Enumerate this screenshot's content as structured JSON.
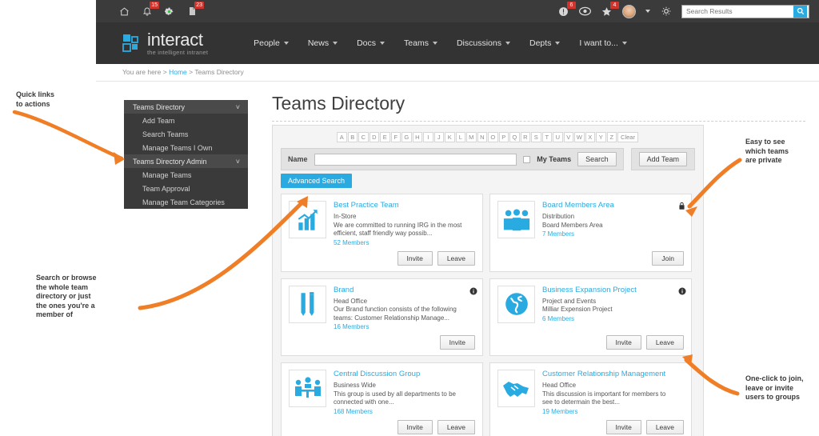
{
  "topbar": {
    "left_icons": [
      {
        "name": "home-icon",
        "badge": null
      },
      {
        "name": "bell-icon",
        "badge": "15"
      },
      {
        "name": "settings-gear-icon",
        "badge": null
      },
      {
        "name": "document-icon",
        "badge": "23"
      }
    ],
    "right_icons": [
      {
        "name": "alert-icon",
        "badge": "6"
      },
      {
        "name": "eye-icon",
        "badge": null
      },
      {
        "name": "star-icon",
        "badge": "4"
      }
    ],
    "avatar_name": "user-avatar",
    "search": {
      "placeholder": "Search Results",
      "value": ""
    }
  },
  "brand": {
    "name": "interact",
    "tagline": "the intelligent intranet"
  },
  "nav": [
    {
      "label": "People"
    },
    {
      "label": "News"
    },
    {
      "label": "Docs"
    },
    {
      "label": "Teams"
    },
    {
      "label": "Discussions"
    },
    {
      "label": "Depts"
    },
    {
      "label": "I want to..."
    }
  ],
  "breadcrumb": {
    "prefix": "You are here >",
    "home": "Home",
    "suffix": "> Teams Directory"
  },
  "sidebar": {
    "groups": [
      {
        "title": "Teams Directory",
        "chevron": "chevron-down-icon",
        "items": [
          "Add Team",
          "Search Teams",
          "Manage Teams I Own"
        ]
      },
      {
        "title": "Teams Directory Admin",
        "chevron": "chevron-down-icon",
        "items": [
          "Manage Teams",
          "Team Approval",
          "Manage Team Categories"
        ]
      }
    ]
  },
  "main": {
    "title": "Teams Directory",
    "alphabet": [
      "A",
      "B",
      "C",
      "D",
      "E",
      "F",
      "G",
      "H",
      "I",
      "J",
      "K",
      "L",
      "M",
      "N",
      "O",
      "P",
      "Q",
      "R",
      "S",
      "T",
      "U",
      "V",
      "W",
      "X",
      "Y",
      "Z"
    ],
    "clear_label": "Clear",
    "search": {
      "name_label": "Name",
      "name_value": "",
      "my_teams_label": "My Teams",
      "my_teams_checked": false,
      "search_button": "Search",
      "add_team_button": "Add Team",
      "advanced_search_button": "Advanced Search"
    },
    "cards": [
      {
        "title": "Best Practice Team",
        "category": "In-Store",
        "description": "We are committed to running IRG in the most efficient, staff friendly way possib...",
        "members": "52 Members",
        "flag": null,
        "icon": "bar-chart-icon",
        "actions": [
          "Invite",
          "Leave"
        ]
      },
      {
        "title": "Board Members Area",
        "category": "Distribution",
        "description": "Board Members Area",
        "members": "7 Members",
        "flag": "lock-icon",
        "icon": "people-group-icon",
        "actions": [
          "Join"
        ]
      },
      {
        "title": "Brand",
        "category": "Head Office",
        "description": "Our Brand function consists of the following teams: Customer Relationship Manage...",
        "members": "16 Members",
        "flag": "info-icon",
        "icon": "pencils-icon",
        "actions": [
          "Invite"
        ]
      },
      {
        "title": "Business Expansion Project",
        "category": "Project and Events",
        "description": "Milliar Expension Project",
        "members": "6 Members",
        "flag": "info-icon",
        "icon": "globe-icon",
        "actions": [
          "Invite",
          "Leave"
        ]
      },
      {
        "title": "Central Discussion Group",
        "category": "Business Wide",
        "description": "This group is used by all departments to be connected with one...",
        "members": "168 Members",
        "flag": null,
        "icon": "meeting-icon",
        "actions": [
          "Invite",
          "Leave"
        ]
      },
      {
        "title": "Customer Relationship Management",
        "category": "Head Office",
        "description": "This discussion is important for members to see to determain the best...",
        "members": "19 Members",
        "flag": null,
        "icon": "handshake-icon",
        "actions": [
          "Invite",
          "Leave"
        ]
      }
    ]
  },
  "annotations": [
    {
      "id": "a1",
      "text": "Quick links\nto actions"
    },
    {
      "id": "a2",
      "text": "Search or browse\nthe whole team\ndirectory or just\nthe ones you're a\nmember of"
    },
    {
      "id": "a3",
      "text": "Easy to see\nwhich teams\nare private"
    },
    {
      "id": "a4",
      "text": "One-click to join,\nleave or invite\nusers to groups"
    }
  ],
  "colors": {
    "accent": "#29ABE2",
    "annotation": "#F07E26",
    "header": "#333333",
    "topbar": "#3b3b3b",
    "badge": "#d0342c"
  }
}
